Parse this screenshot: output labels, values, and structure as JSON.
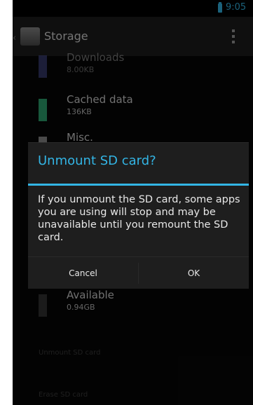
{
  "status_bar": {
    "time": "9:05",
    "battery_icon": "battery-charging-icon"
  },
  "action_bar": {
    "title": "Storage",
    "overflow_icon": "overflow-menu-icon"
  },
  "storage_list": [
    {
      "title": "Downloads",
      "subtitle": "8.00KB",
      "color": "#5a63b8"
    },
    {
      "title": "Cached data",
      "subtitle": "136KB",
      "color": "#2da36f"
    },
    {
      "title": "Misc.",
      "subtitle": "",
      "color": "#8a8a8a"
    },
    {
      "title": "Available",
      "subtitle": "0.94GB",
      "color": "#333333"
    }
  ],
  "faint_rows": [
    "Unmount SD card",
    "Erase SD card"
  ],
  "dialog": {
    "title": "Unmount SD card?",
    "message": "If you unmount the SD card, some apps you are using will stop and may be unavailable until you remount the SD card.",
    "cancel_label": "Cancel",
    "ok_label": "OK"
  },
  "colors": {
    "accent": "#33b5e5",
    "background": "#0a0a0a",
    "dialog_background": "#1e1e1e"
  }
}
